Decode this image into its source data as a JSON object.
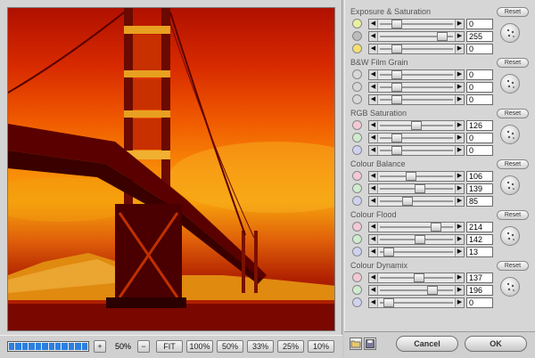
{
  "zoom": {
    "level_label": "50%",
    "plus_label": "+",
    "minus_label": "−",
    "progress_fraction": 1.0,
    "buttons": [
      "FIT",
      "100%",
      "50%",
      "33%",
      "25%",
      "10%"
    ]
  },
  "panel": {
    "reset_label": "Reset",
    "sections": [
      {
        "title": "Exposure & Saturation",
        "rows": [
          {
            "channel": "exposure-icon",
            "value": "0",
            "pos": 0.19
          },
          {
            "channel": "contrast-icon",
            "value": "255",
            "pos": 0.92
          },
          {
            "channel": "saturation-icon",
            "value": "0",
            "pos": 0.19
          }
        ]
      },
      {
        "title": "B&W Film Grain",
        "rows": [
          {
            "channel": "grain-dot",
            "value": "0",
            "pos": 0.19
          },
          {
            "channel": "grain-dot",
            "value": "0",
            "pos": 0.19
          },
          {
            "channel": "grain-dot",
            "value": "0",
            "pos": 0.19
          }
        ]
      },
      {
        "title": "RGB Saturation",
        "rows": [
          {
            "channel": "red-dot",
            "value": "126",
            "pos": 0.5
          },
          {
            "channel": "green-dot",
            "value": "0",
            "pos": 0.19
          },
          {
            "channel": "blue-dot",
            "value": "0",
            "pos": 0.19
          }
        ]
      },
      {
        "title": "Colour Balance",
        "rows": [
          {
            "channel": "red-dot",
            "value": "106",
            "pos": 0.42
          },
          {
            "channel": "green-dot",
            "value": "139",
            "pos": 0.55
          },
          {
            "channel": "blue-dot",
            "value": "85",
            "pos": 0.35
          }
        ]
      },
      {
        "title": "Colour Flood",
        "rows": [
          {
            "channel": "red-dot",
            "value": "214",
            "pos": 0.82
          },
          {
            "channel": "green-dot",
            "value": "142",
            "pos": 0.56
          },
          {
            "channel": "blue-dot",
            "value": "13",
            "pos": 0.05
          }
        ]
      },
      {
        "title": "Colour Dynamix",
        "rows": [
          {
            "channel": "red-dot",
            "value": "137",
            "pos": 0.54
          },
          {
            "channel": "green-dot",
            "value": "196",
            "pos": 0.76
          },
          {
            "channel": "blue-dot",
            "value": "0",
            "pos": 0.05
          }
        ]
      }
    ]
  },
  "actions": {
    "cancel_label": "Cancel",
    "ok_label": "OK"
  },
  "colors": {
    "progress": "#2a7fe0",
    "red_dot": "#f4c8d4",
    "green_dot": "#cfeccf",
    "blue_dot": "#cfd2f0"
  }
}
